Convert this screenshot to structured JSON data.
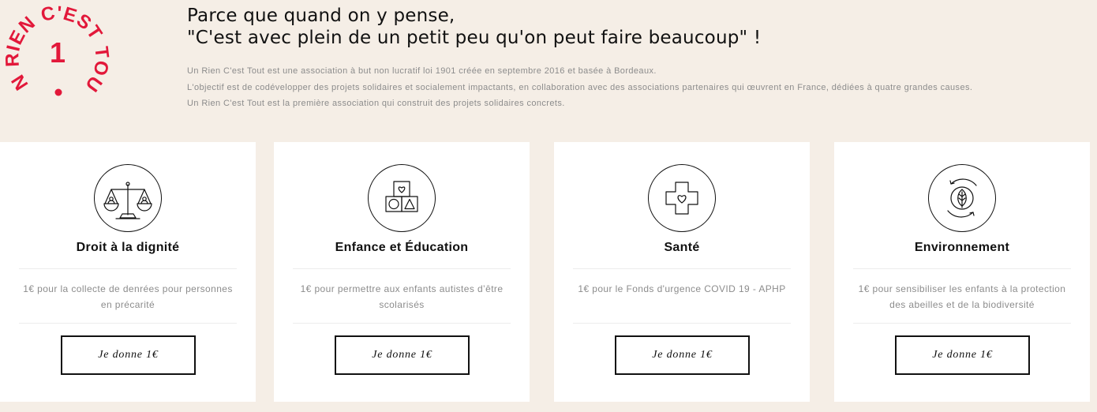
{
  "brand": {
    "logo_text": "UN RIEN C'EST TOUT",
    "logo_number": "1",
    "accent_color": "#e2183a"
  },
  "header": {
    "headline_line1": "Parce que quand on y pense,",
    "headline_line2": "\"C'est avec plein de un petit peu qu'on peut faire beaucoup\" !",
    "description": [
      "Un Rien C'est Tout est une association à but non lucratif loi 1901 créée en septembre 2016 et basée à Bordeaux.",
      "L'objectif est de codévelopper des projets solidaires et socialement impactants, en collaboration avec des associations partenaires qui œuvrent en France, dédiées à quatre grandes causes.",
      "Un Rien C'est Tout est la première association qui construit des projets solidaires concrets."
    ]
  },
  "causes": [
    {
      "icon": "scales-icon",
      "title": "Droit à la dignité",
      "text": "1€ pour la collecte de denrées pour personnes en précarité",
      "button_label": "Je donne 1€"
    },
    {
      "icon": "blocks-icon",
      "title": "Enfance et Éducation",
      "text": "1€ pour permettre aux enfants autistes d’être scolarisés",
      "button_label": "Je donne 1€"
    },
    {
      "icon": "medical-cross-icon",
      "title": "Santé",
      "text": "1€ pour le Fonds d'urgence COVID 19 - APHP",
      "button_label": "Je donne 1€"
    },
    {
      "icon": "leaf-icon",
      "title": "Environnement",
      "text": "1€ pour sensibiliser les enfants à la protection des abeilles et de la biodiversité",
      "button_label": "Je donne 1€"
    }
  ]
}
